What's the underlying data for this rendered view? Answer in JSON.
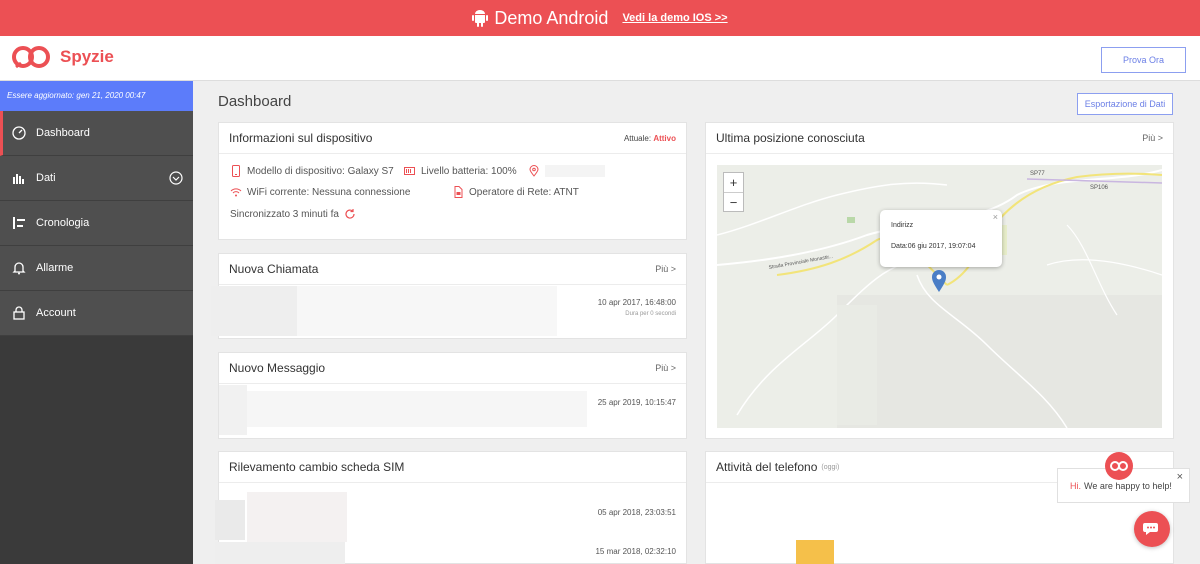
{
  "banner": {
    "title": "Demo Android",
    "link": "Vedi la demo IOS >>",
    "icon": "android-icon"
  },
  "header": {
    "brand": "Spyzie",
    "try_button": "Prova Ora"
  },
  "sidebar": {
    "updated": "Essere aggiornato: gen 21, 2020 00:47",
    "items": [
      {
        "label": "Dashboard",
        "icon": "gauge-icon"
      },
      {
        "label": "Dati",
        "icon": "bar-chart-icon"
      },
      {
        "label": "Cronologia",
        "icon": "timeline-icon"
      },
      {
        "label": "Allarme",
        "icon": "bell-icon"
      },
      {
        "label": "Account",
        "icon": "lock-icon"
      }
    ]
  },
  "main": {
    "title": "Dashboard",
    "export_button": "Esportazione di Dati"
  },
  "device_card": {
    "title": "Informazioni sul dispositivo",
    "status_label": "Attuale:",
    "status_value": "Attivo",
    "model": "Modello di dispositivo: Galaxy S7",
    "battery": "Livello batteria: 100%",
    "wifi": "WiFi corrente: Nessuna connessione",
    "operator": "Operatore di Rete: ATNT",
    "synced": "Sincronizzato 3 minuti fa"
  },
  "call_card": {
    "title": "Nuova Chiamata",
    "more": "Più >",
    "time": "10 apr 2017, 16:48:00",
    "duration": "Dura per 0 secondi"
  },
  "message_card": {
    "title": "Nuovo Messaggio",
    "more": "Più >",
    "time": "25 apr 2019, 10:15:47"
  },
  "sim_card": {
    "title": "Rilevamento cambio scheda SIM",
    "time1": "05 apr 2018, 23:03:51",
    "time2": "15 mar 2018, 02:32:10"
  },
  "location_card": {
    "title": "Ultima posizione conosciuta",
    "more": "Più >",
    "popup_address": "Indirizz",
    "popup_date": "Data:06 giu 2017, 19:07:04",
    "road1": "SP77",
    "road2": "SP106",
    "road3": "Strada Provinciale Monastir..."
  },
  "activity_card": {
    "title": "Attività del telefono",
    "subtitle": "(oggi)"
  },
  "chat": {
    "hi": "Hi.",
    "message": "We are happy to help!"
  },
  "colors": {
    "brand_red": "#ec5054",
    "accent_blue": "#5c7cfa"
  }
}
